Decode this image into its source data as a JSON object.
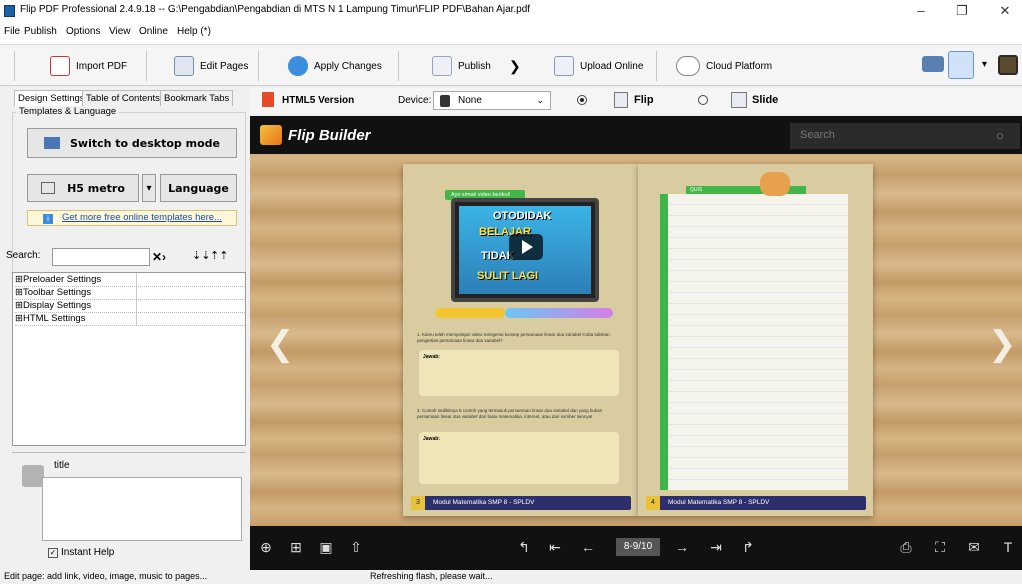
{
  "window": {
    "title": "Flip PDF Professional 2.4.9.18 -- G:\\Pengabdian\\Pengabdian di  MTS N 1 Lampung Timur\\FLIP PDF\\Bahan Ajar.pdf",
    "controls": {
      "minimize": "–",
      "maximize": "❐",
      "close": "✕"
    }
  },
  "menu": [
    "File",
    "Publish",
    "Options",
    "View",
    "Online",
    "Help (*)"
  ],
  "toolbar": {
    "import_pdf": "Import PDF",
    "edit_pages": "Edit Pages",
    "apply_changes": "Apply Changes",
    "publish": "Publish",
    "upload_online": "Upload Online",
    "cloud_platform": "Cloud Platform",
    "arrow": "❯"
  },
  "left_panel": {
    "tabs": [
      "Design Settings",
      "Table of Contents",
      "Bookmark Tabs"
    ],
    "templates_caption": "Templates & Language",
    "switch_desktop": "Switch to desktop mode",
    "template_name": "H5 metro",
    "template_dropdown": "▾",
    "language": "Language",
    "more_templates": "Get more free online templates here...",
    "search_label": "Search:",
    "search_value": "",
    "tree_items": [
      "⊞Preloader Settings",
      "⊞Toolbar Settings",
      "⊞Display Settings",
      "⊞HTML Settings"
    ],
    "help_title": "title",
    "instant_help": "Instant Help",
    "instant_help_checked": true
  },
  "preview": {
    "html5_label": "HTML5 Version",
    "device_label": "Device:",
    "device_value": "None",
    "mode_flip": "Flip",
    "mode_slide": "Slide",
    "selected_mode": "Flip",
    "logo_text": "Flip Builder",
    "search_placeholder": "Search",
    "page_indicator": "8-9/10",
    "left_page": {
      "tag": "Ayo simak video berikut!",
      "video_lines": [
        "OTODIDAK",
        "BELAJAR",
        "TIDAK",
        "SULIT LAGI"
      ],
      "q1": "1. Kamu telah mempelajari video mengenai konsep persamaan linear dua variabel Coba tuliskan pengertian persamaan linear dua variabel?",
      "q2": "2. Contoh sedikitnya 5 contoh yang termasuk persamaan linear dua variabel dan yang bukan persamaan linear dua variabel dari buku matematika, internet, atau dari sumber lainnya!",
      "answer_label": "Jawab:",
      "footer": "Modul Matematika SMP 8 - SPLDV",
      "page_num": "3"
    },
    "right_page": {
      "tag": "QUIS",
      "footer": "Modul Matematika SMP 8 - SPLDV",
      "page_num": "4"
    }
  },
  "status": {
    "left": "Edit page: add link, video, image, music to pages...",
    "right": "Refreshing flash, please wait..."
  }
}
